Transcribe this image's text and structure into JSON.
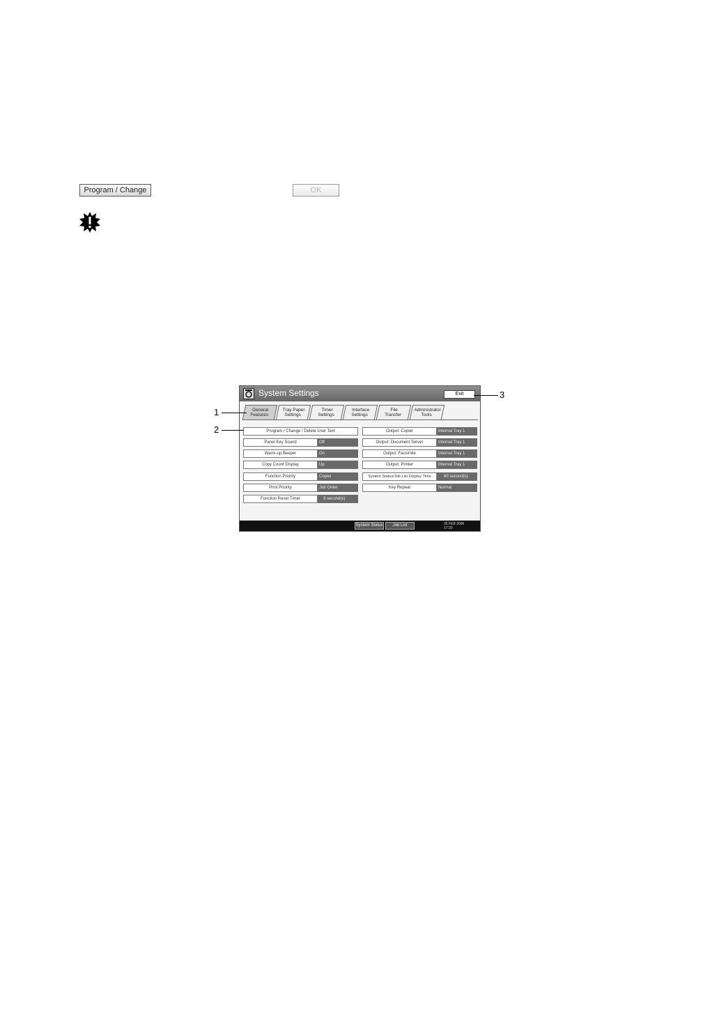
{
  "top_buttons": {
    "program_change": "Program / Change",
    "ok": "OK"
  },
  "screen": {
    "title": "System Settings",
    "exit": "Exit",
    "tabs": [
      {
        "line1": "General",
        "line2": "Features",
        "active": true
      },
      {
        "line1": "Tray Paper",
        "line2": "Settings"
      },
      {
        "line1": "Timer",
        "line2": "Settings"
      },
      {
        "line1": "Interface",
        "line2": "Settings"
      },
      {
        "line1": "File",
        "line2": "Transfer"
      },
      {
        "line1": "Administrator",
        "line2": "Tools"
      }
    ],
    "left_rows": [
      {
        "label": "Program / Change / Delete User Text"
      },
      {
        "label": "Panel Key Sound",
        "value": "Off"
      },
      {
        "label": "Warm-up Beeper",
        "value": "On"
      },
      {
        "label": "Copy Count Display",
        "value": "Up"
      },
      {
        "label": "Function Priority",
        "value": "Copier"
      },
      {
        "label": "Print Priority",
        "value": "Job Order"
      },
      {
        "label": "Function Reset Timer",
        "value": "3 second(s)"
      }
    ],
    "right_rows": [
      {
        "label": "Output: Copier",
        "value": "Internal Tray 1"
      },
      {
        "label": "Output: Document Server",
        "value": "Internal Tray 1"
      },
      {
        "label": "Output: Facsimile",
        "value": "Internal Tray 1"
      },
      {
        "label": "Output: Printer",
        "value": "Internal Tray 1"
      },
      {
        "label": "System Status/Job List Display Time",
        "value": "60 second(s)"
      },
      {
        "label": "Key Repeat",
        "value": "Normal"
      }
    ],
    "bottom": {
      "system_status": "System Status",
      "job_list": "Job List",
      "date": "26 FEB 2006",
      "time": "17:20"
    }
  },
  "callouts": [
    "1",
    "2",
    "3"
  ]
}
